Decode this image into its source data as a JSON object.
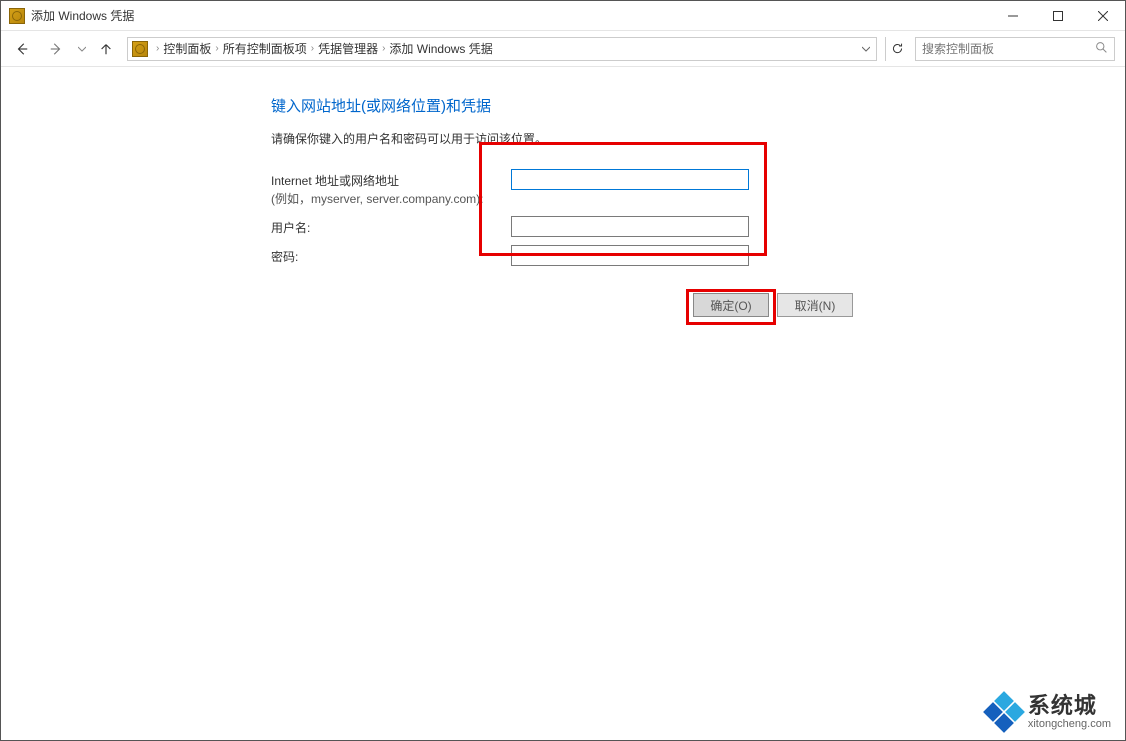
{
  "window": {
    "title": "添加 Windows 凭据"
  },
  "breadcrumb": {
    "items": [
      "控制面板",
      "所有控制面板项",
      "凭据管理器",
      "添加 Windows 凭据"
    ]
  },
  "search": {
    "placeholder": "搜索控制面板"
  },
  "page": {
    "heading": "键入网站地址(或网络位置)和凭据",
    "subtext": "请确保你键入的用户名和密码可以用于访问该位置。"
  },
  "form": {
    "address_label": "Internet 地址或网络地址",
    "address_example": "(例如，myserver, server.company.com):",
    "address_value": "",
    "username_label": "用户名:",
    "username_value": "",
    "password_label": "密码:",
    "password_value": ""
  },
  "buttons": {
    "ok": "确定(O)",
    "cancel": "取消(N)"
  },
  "watermark": {
    "cn": "系统城",
    "en": "xitongcheng.com"
  }
}
